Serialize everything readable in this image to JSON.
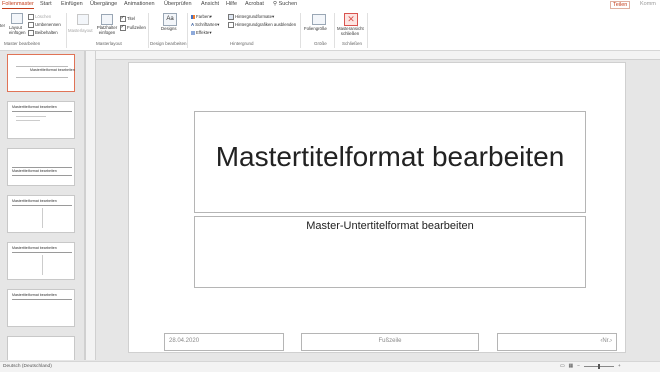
{
  "tabs": [
    "Folienmaster",
    "Start",
    "Einfügen",
    "Übergänge",
    "Animationen",
    "Überprüfen",
    "Ansicht",
    "Hilfe",
    "Acrobat"
  ],
  "search_label": "Suchen",
  "share_label": "Teilen",
  "comment_label": "Komm",
  "ribbon": {
    "master_bearbeiten": {
      "insert_master": "ter",
      "insert_layout": "Layout einfügen",
      "delete": "Löschen",
      "rename": "Umbenennen",
      "preserve": "Beibehalten",
      "group_label": "Master bearbeiten"
    },
    "masterlayout": {
      "masterlayout_btn": "Masterlayout",
      "placeholder_btn": "Platzhalter einfügen",
      "title_chk": "Titel",
      "footer_chk": "Fußzeilen",
      "group_label": "Masterlayout"
    },
    "design": {
      "designs_btn": "Designs",
      "group_label": "Design bearbeiten"
    },
    "hintergrund": {
      "colors": "Farben",
      "fonts": "Schriftarten",
      "effects": "Effekte",
      "bgformats": "Hintergrundformate",
      "hide_bg": "Hintergrundgrafiken ausblenden",
      "group_label": "Hintergrund"
    },
    "groesse": {
      "slide_size": "Foliengröße",
      "group_label": "Größe"
    },
    "schliessen": {
      "close_btn": "Masteransicht schließen",
      "group_label": "Schließen"
    }
  },
  "thumbnails": [
    {
      "title": "Mastertitelformat bearbeiten",
      "selected": true
    },
    {
      "title": "Mastertitelformat bearbeiten",
      "selected": false
    },
    {
      "title": "Mastertitelformat bearbeiten",
      "selected": false
    },
    {
      "title": "Mastertitelformat bearbeiten",
      "selected": false
    },
    {
      "title": "Mastertitelformat bearbeiten",
      "selected": false
    },
    {
      "title": "Mastertitelformat bearbeiten",
      "selected": false
    }
  ],
  "slide": {
    "title": "Mastertitelformat bearbeiten",
    "subtitle": "Master-Untertitelformat bearbeiten",
    "date": "28.04.2020",
    "footer": "Fußzeile",
    "slide_number": "‹Nr.›"
  },
  "status": {
    "language": "Deutsch (Deutschland)"
  },
  "colors": {
    "accent": "#c43e1c",
    "selected_border": "#e07356"
  }
}
